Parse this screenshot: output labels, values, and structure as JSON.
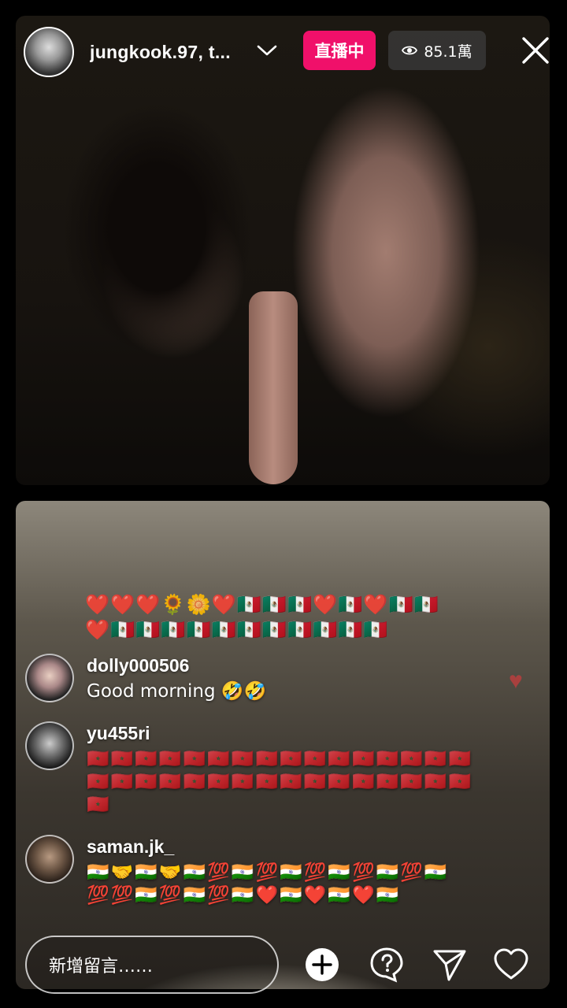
{
  "header": {
    "username": "jungkook.97, t...",
    "live_label": "直播中",
    "viewer_count": "85.1萬"
  },
  "reactions": {
    "line1": "❤️❤️❤️🌻🌼❤️🇲🇽🇲🇽🇲🇽❤️🇲🇽❤️🇲🇽🇲🇽",
    "line2": "❤️🇲🇽🇲🇽🇲🇽🇲🇽🇲🇽🇲🇽🇲🇽🇲🇽🇲🇽🇲🇽🇲🇽"
  },
  "comments": [
    {
      "user": "dolly000506",
      "text": "Good morning 🤣🤣"
    },
    {
      "user": "yu455ri",
      "text": "🇲🇦🇲🇦🇲🇦🇲🇦🇲🇦🇲🇦🇲🇦🇲🇦🇲🇦🇲🇦🇲🇦🇲🇦🇲🇦🇲🇦🇲🇦🇲🇦🇲🇦🇲🇦🇲🇦🇲🇦🇲🇦🇲🇦🇲🇦🇲🇦🇲🇦🇲🇦🇲🇦🇲🇦🇲🇦🇲🇦🇲🇦🇲🇦🇲🇦"
    },
    {
      "user": "saman.jk_",
      "text": "🇮🇳🤝🇮🇳🤝🇮🇳💯🇮🇳💯🇮🇳💯🇮🇳💯🇮🇳💯🇮🇳💯💯🇮🇳💯🇮🇳💯🇮🇳❤️🇮🇳❤️🇮🇳❤️🇮🇳"
    }
  ],
  "footer": {
    "comment_placeholder": "新增留言……"
  },
  "icons": [
    "chevron-down-icon",
    "eye-icon",
    "close-icon",
    "add-icon",
    "question-icon",
    "send-icon",
    "heart-icon"
  ],
  "colors": {
    "live": "#f0106a"
  }
}
